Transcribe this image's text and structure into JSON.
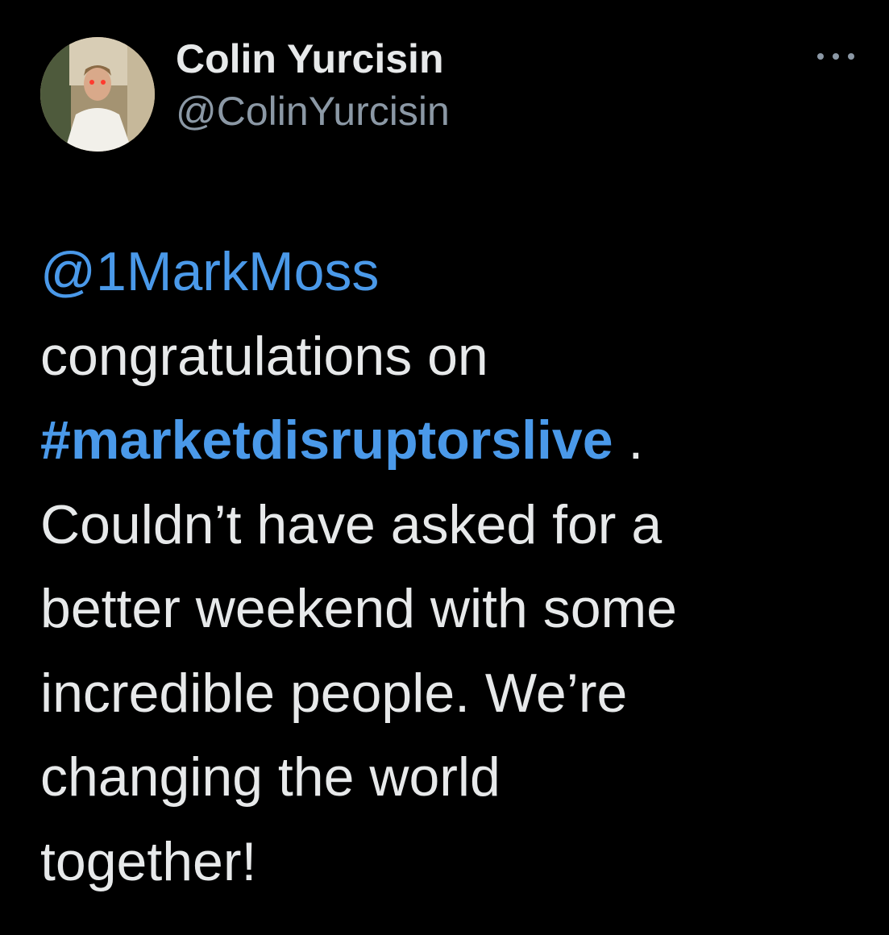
{
  "author": {
    "display_name": "Colin Yurcisin",
    "handle": "@ColinYurcisin"
  },
  "more_icon": "more-horizontal-icon",
  "tweet": {
    "mention": "@1MarkMoss",
    "line_2": "congratulations on",
    "hashtag": "#marketdisruptorslive",
    "hashtag_suffix": " .",
    "line_4": "Couldn’t have asked for a",
    "line_5": "better weekend with some",
    "line_6": "incredible people. We’re",
    "line_7": "changing the world",
    "line_8": "together!"
  },
  "colors": {
    "background": "#000000",
    "text": "#e7e9ea",
    "secondary": "#8b98a5",
    "link": "#4a99e9"
  }
}
